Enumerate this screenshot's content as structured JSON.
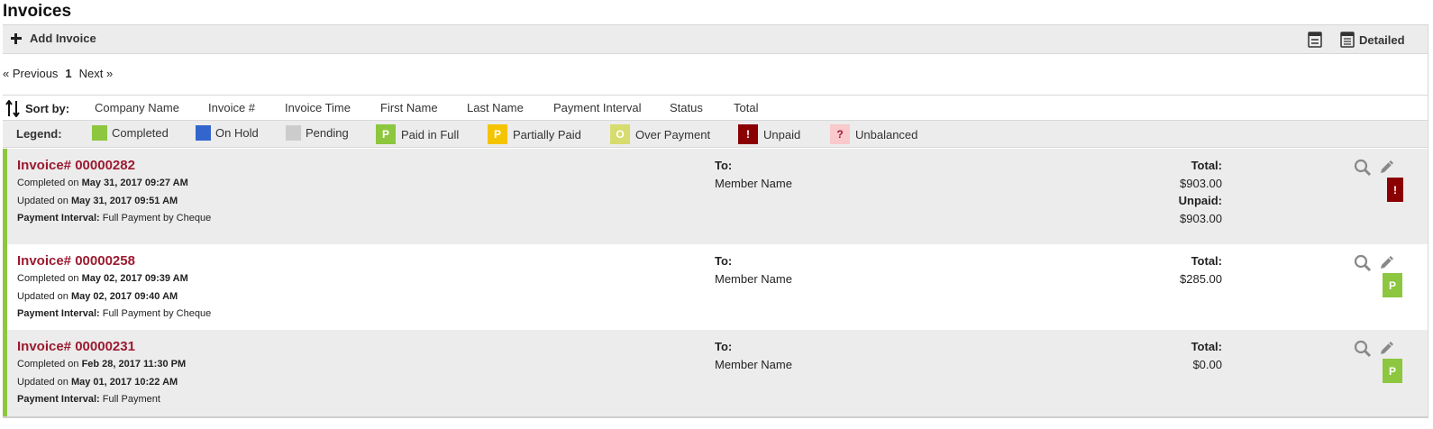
{
  "page": {
    "title": "Invoices"
  },
  "toolbar": {
    "add_label": "Add Invoice",
    "detailed_label": "Detailed",
    "icons": {
      "add": "plus-icon",
      "compact": "compact-view-icon",
      "detailed": "detailed-view-icon"
    }
  },
  "pager": {
    "prev": "« Previous",
    "current": "1",
    "next": "Next »"
  },
  "sort": {
    "label": "Sort by:",
    "icon": "sort-icon",
    "columns": [
      "Company Name",
      "Invoice #",
      "Invoice Time",
      "First Name",
      "Last Name",
      "Payment Interval",
      "Status",
      "Total"
    ]
  },
  "legend": {
    "label": "Legend:",
    "items": [
      {
        "label": "Completed",
        "color": "#8dc63f",
        "glyph": ""
      },
      {
        "label": "On Hold",
        "color": "#3366cc",
        "glyph": ""
      },
      {
        "label": "Pending",
        "color": "#cccccc",
        "glyph": ""
      },
      {
        "label": "Paid in Full",
        "color": "#8dc63f",
        "glyph": "P"
      },
      {
        "label": "Partially Paid",
        "color": "#f5c400",
        "glyph": "P"
      },
      {
        "label": "Over Payment",
        "color": "#d6dc6e",
        "glyph": "O"
      },
      {
        "label": "Unpaid",
        "color": "#8b0000",
        "glyph": "!"
      },
      {
        "label": "Unbalanced",
        "color": "#f9c9cc",
        "glyph": "?"
      }
    ]
  },
  "colors": {
    "accent_completed": "#8dc63f",
    "invoice_number": "#9b1b30"
  },
  "invoices": [
    {
      "number": "Invoice# 00000282",
      "completed_prefix": "Completed on",
      "completed": "May 31, 2017 09:27 AM",
      "updated_prefix": "Updated on",
      "updated": "May 31, 2017 09:51 AM",
      "interval_label": "Payment Interval:",
      "interval": "Full Payment by Cheque",
      "to_label": "To:",
      "to_name": "Member Name",
      "total_label": "Total:",
      "total": "$903.00",
      "unpaid_label": "Unpaid:",
      "unpaid": "$903.00",
      "status_glyph": "!",
      "status_color": "#8b0000"
    },
    {
      "number": "Invoice# 00000258",
      "completed_prefix": "Completed on",
      "completed": "May 02, 2017 09:39 AM",
      "updated_prefix": "Updated on",
      "updated": "May 02, 2017 09:40 AM",
      "interval_label": "Payment Interval:",
      "interval": "Full Payment by Cheque",
      "to_label": "To:",
      "to_name": "Member Name",
      "total_label": "Total:",
      "total": "$285.00",
      "status_glyph": "P",
      "status_color": "#8dc63f"
    },
    {
      "number": "Invoice# 00000231",
      "completed_prefix": "Completed on",
      "completed": "Feb 28, 2017 11:30 PM",
      "updated_prefix": "Updated on",
      "updated": "May 01, 2017 10:22 AM",
      "interval_label": "Payment Interval:",
      "interval": "Full Payment",
      "to_label": "To:",
      "to_name": "Member Name",
      "total_label": "Total:",
      "total": "$0.00",
      "status_glyph": "P",
      "status_color": "#8dc63f"
    }
  ]
}
